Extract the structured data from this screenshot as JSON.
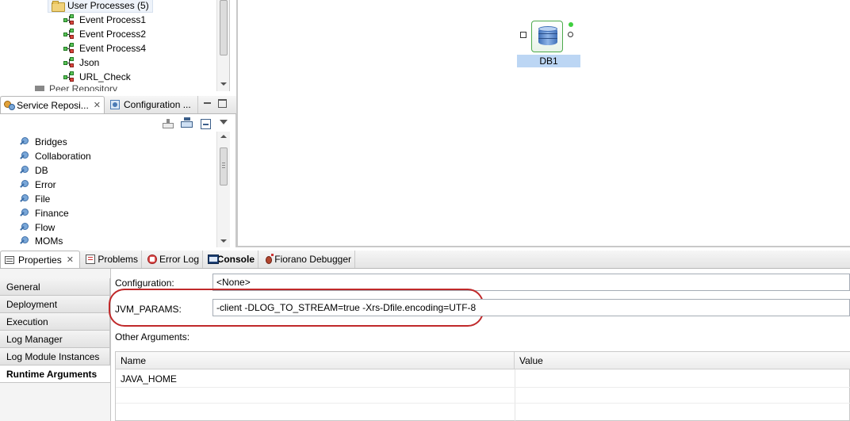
{
  "tree": {
    "folder_label": "User Processes (5)",
    "items": [
      "Event Process1",
      "Event Process2",
      "Event Process4",
      "Json",
      "URL_Check"
    ],
    "partial_label": "Peer Repository"
  },
  "service_tabs": {
    "service_repository": "Service Reposi...",
    "configuration": "Configuration ..."
  },
  "service_items": [
    "Bridges",
    "Collaboration",
    "DB",
    "Error",
    "File",
    "Finance",
    "Flow",
    "MOMs"
  ],
  "canvas": {
    "node_label": "DB1"
  },
  "bottom_tabs": {
    "properties": "Properties",
    "problems": "Problems",
    "error_log": "Error Log",
    "console": "Console",
    "debugger": "Fiorano Debugger"
  },
  "side_tabs": [
    "General",
    "Deployment",
    "Execution",
    "Log Manager",
    "Log Module Instances",
    "Runtime Arguments"
  ],
  "form": {
    "configuration_label": "Configuration:",
    "configuration_value": "<None>",
    "jvm_label": "JVM_PARAMS:",
    "jvm_value": "-client -DLOG_TO_STREAM=true -Xrs-Dfile.encoding=UTF-8",
    "other_args_label": "Other Arguments:"
  },
  "table": {
    "columns": [
      "Name",
      "Value"
    ],
    "rows": [
      [
        "JAVA_HOME",
        ""
      ]
    ]
  },
  "colors": {
    "highlight": "#c0292a",
    "selection": "#bcd6f4",
    "port_green": "#3fcf3f"
  }
}
